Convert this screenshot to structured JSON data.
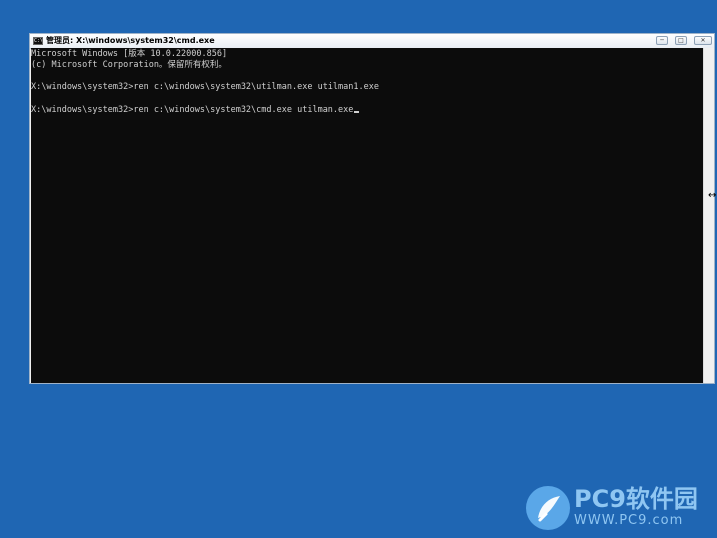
{
  "window": {
    "title": "管理员: X:\\windows\\system32\\cmd.exe",
    "controls": {
      "minimize": "─",
      "maximize": "□",
      "close": "✕"
    }
  },
  "console": {
    "lines": [
      "Microsoft Windows [版本 10.0.22000.856]",
      "(c) Microsoft Corporation。保留所有权利。",
      "",
      "X:\\windows\\system32>ren c:\\windows\\system32\\utilman.exe utilman1.exe",
      "",
      "X:\\windows\\system32>ren c:\\windows\\system32\\cmd.exe utilman.exe"
    ]
  },
  "desktop": {
    "resize_cursor_glyph": "↔"
  },
  "watermark": {
    "title": "PC9软件园",
    "url": "WWW.PC9.com"
  },
  "colors": {
    "desktop": "#1f66b3",
    "console_bg": "#0c0c0c",
    "console_text": "#d0d0d0",
    "watermark": "#8fc6f2"
  }
}
